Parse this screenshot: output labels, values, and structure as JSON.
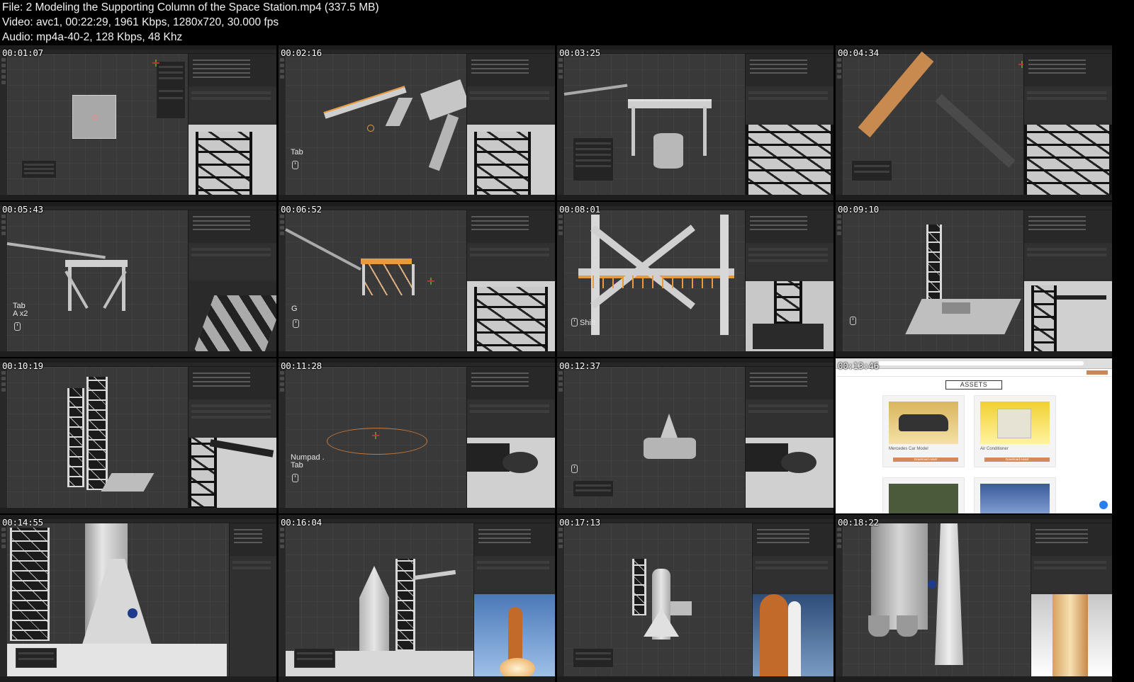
{
  "header": {
    "file_line": "File: 2  Modeling the Supporting Column of the Space Station.mp4 (337.5 MB)",
    "video_line": "Video: avc1, 00:22:29, 1961 Kbps, 1280x720, 30.000 fps",
    "audio_line": "Audio: mp4a-40-2, 128 Kbps, 48 Khz"
  },
  "thumbnails": [
    {
      "time": "00:01:07"
    },
    {
      "time": "00:02:16",
      "key": "Tab"
    },
    {
      "time": "00:03:25"
    },
    {
      "time": "00:04:34"
    },
    {
      "time": "00:05:43",
      "key": "Tab\nA x2"
    },
    {
      "time": "00:06:52",
      "key": "G"
    },
    {
      "time": "00:08:01",
      "key": "Shift"
    },
    {
      "time": "00:09:10"
    },
    {
      "time": "00:10:19"
    },
    {
      "time": "00:11:28",
      "key": "Numpad .\nTab"
    },
    {
      "time": "00:12:37"
    },
    {
      "time": "00:13:46"
    },
    {
      "time": "00:14:55"
    },
    {
      "time": "00:16:04"
    },
    {
      "time": "00:17:13"
    },
    {
      "time": "00:18:22"
    }
  ],
  "web_page": {
    "section_title": "ASSETS",
    "cards": [
      {
        "caption": "Mercedes Car Model",
        "button": "Download Asset"
      },
      {
        "caption": "Air Conditioner",
        "button": "Download Asset"
      }
    ]
  },
  "colors": {
    "background": "#000000",
    "viewport": "#393939",
    "accent_orange": "#d4895a",
    "selection_orange": "#e89a3c"
  }
}
